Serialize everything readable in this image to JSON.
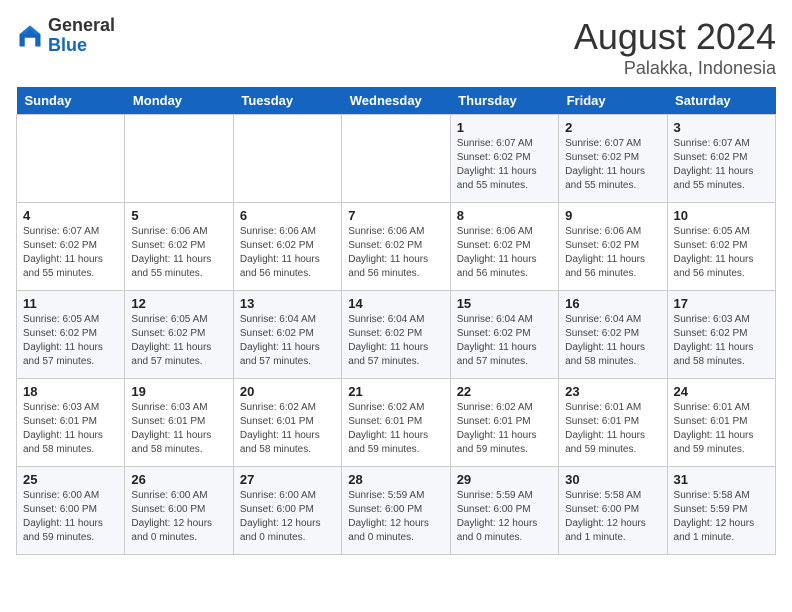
{
  "header": {
    "logo_general": "General",
    "logo_blue": "Blue",
    "month_year": "August 2024",
    "location": "Palakka, Indonesia"
  },
  "days_of_week": [
    "Sunday",
    "Monday",
    "Tuesday",
    "Wednesday",
    "Thursday",
    "Friday",
    "Saturday"
  ],
  "weeks": [
    [
      {
        "day": "",
        "detail": ""
      },
      {
        "day": "",
        "detail": ""
      },
      {
        "day": "",
        "detail": ""
      },
      {
        "day": "",
        "detail": ""
      },
      {
        "day": "1",
        "detail": "Sunrise: 6:07 AM\nSunset: 6:02 PM\nDaylight: 11 hours\nand 55 minutes."
      },
      {
        "day": "2",
        "detail": "Sunrise: 6:07 AM\nSunset: 6:02 PM\nDaylight: 11 hours\nand 55 minutes."
      },
      {
        "day": "3",
        "detail": "Sunrise: 6:07 AM\nSunset: 6:02 PM\nDaylight: 11 hours\nand 55 minutes."
      }
    ],
    [
      {
        "day": "4",
        "detail": "Sunrise: 6:07 AM\nSunset: 6:02 PM\nDaylight: 11 hours\nand 55 minutes."
      },
      {
        "day": "5",
        "detail": "Sunrise: 6:06 AM\nSunset: 6:02 PM\nDaylight: 11 hours\nand 55 minutes."
      },
      {
        "day": "6",
        "detail": "Sunrise: 6:06 AM\nSunset: 6:02 PM\nDaylight: 11 hours\nand 56 minutes."
      },
      {
        "day": "7",
        "detail": "Sunrise: 6:06 AM\nSunset: 6:02 PM\nDaylight: 11 hours\nand 56 minutes."
      },
      {
        "day": "8",
        "detail": "Sunrise: 6:06 AM\nSunset: 6:02 PM\nDaylight: 11 hours\nand 56 minutes."
      },
      {
        "day": "9",
        "detail": "Sunrise: 6:06 AM\nSunset: 6:02 PM\nDaylight: 11 hours\nand 56 minutes."
      },
      {
        "day": "10",
        "detail": "Sunrise: 6:05 AM\nSunset: 6:02 PM\nDaylight: 11 hours\nand 56 minutes."
      }
    ],
    [
      {
        "day": "11",
        "detail": "Sunrise: 6:05 AM\nSunset: 6:02 PM\nDaylight: 11 hours\nand 57 minutes."
      },
      {
        "day": "12",
        "detail": "Sunrise: 6:05 AM\nSunset: 6:02 PM\nDaylight: 11 hours\nand 57 minutes."
      },
      {
        "day": "13",
        "detail": "Sunrise: 6:04 AM\nSunset: 6:02 PM\nDaylight: 11 hours\nand 57 minutes."
      },
      {
        "day": "14",
        "detail": "Sunrise: 6:04 AM\nSunset: 6:02 PM\nDaylight: 11 hours\nand 57 minutes."
      },
      {
        "day": "15",
        "detail": "Sunrise: 6:04 AM\nSunset: 6:02 PM\nDaylight: 11 hours\nand 57 minutes."
      },
      {
        "day": "16",
        "detail": "Sunrise: 6:04 AM\nSunset: 6:02 PM\nDaylight: 11 hours\nand 58 minutes."
      },
      {
        "day": "17",
        "detail": "Sunrise: 6:03 AM\nSunset: 6:02 PM\nDaylight: 11 hours\nand 58 minutes."
      }
    ],
    [
      {
        "day": "18",
        "detail": "Sunrise: 6:03 AM\nSunset: 6:01 PM\nDaylight: 11 hours\nand 58 minutes."
      },
      {
        "day": "19",
        "detail": "Sunrise: 6:03 AM\nSunset: 6:01 PM\nDaylight: 11 hours\nand 58 minutes."
      },
      {
        "day": "20",
        "detail": "Sunrise: 6:02 AM\nSunset: 6:01 PM\nDaylight: 11 hours\nand 58 minutes."
      },
      {
        "day": "21",
        "detail": "Sunrise: 6:02 AM\nSunset: 6:01 PM\nDaylight: 11 hours\nand 59 minutes."
      },
      {
        "day": "22",
        "detail": "Sunrise: 6:02 AM\nSunset: 6:01 PM\nDaylight: 11 hours\nand 59 minutes."
      },
      {
        "day": "23",
        "detail": "Sunrise: 6:01 AM\nSunset: 6:01 PM\nDaylight: 11 hours\nand 59 minutes."
      },
      {
        "day": "24",
        "detail": "Sunrise: 6:01 AM\nSunset: 6:01 PM\nDaylight: 11 hours\nand 59 minutes."
      }
    ],
    [
      {
        "day": "25",
        "detail": "Sunrise: 6:00 AM\nSunset: 6:00 PM\nDaylight: 11 hours\nand 59 minutes."
      },
      {
        "day": "26",
        "detail": "Sunrise: 6:00 AM\nSunset: 6:00 PM\nDaylight: 12 hours\nand 0 minutes."
      },
      {
        "day": "27",
        "detail": "Sunrise: 6:00 AM\nSunset: 6:00 PM\nDaylight: 12 hours\nand 0 minutes."
      },
      {
        "day": "28",
        "detail": "Sunrise: 5:59 AM\nSunset: 6:00 PM\nDaylight: 12 hours\nand 0 minutes."
      },
      {
        "day": "29",
        "detail": "Sunrise: 5:59 AM\nSunset: 6:00 PM\nDaylight: 12 hours\nand 0 minutes."
      },
      {
        "day": "30",
        "detail": "Sunrise: 5:58 AM\nSunset: 6:00 PM\nDaylight: 12 hours\nand 1 minute."
      },
      {
        "day": "31",
        "detail": "Sunrise: 5:58 AM\nSunset: 5:59 PM\nDaylight: 12 hours\nand 1 minute."
      }
    ]
  ]
}
